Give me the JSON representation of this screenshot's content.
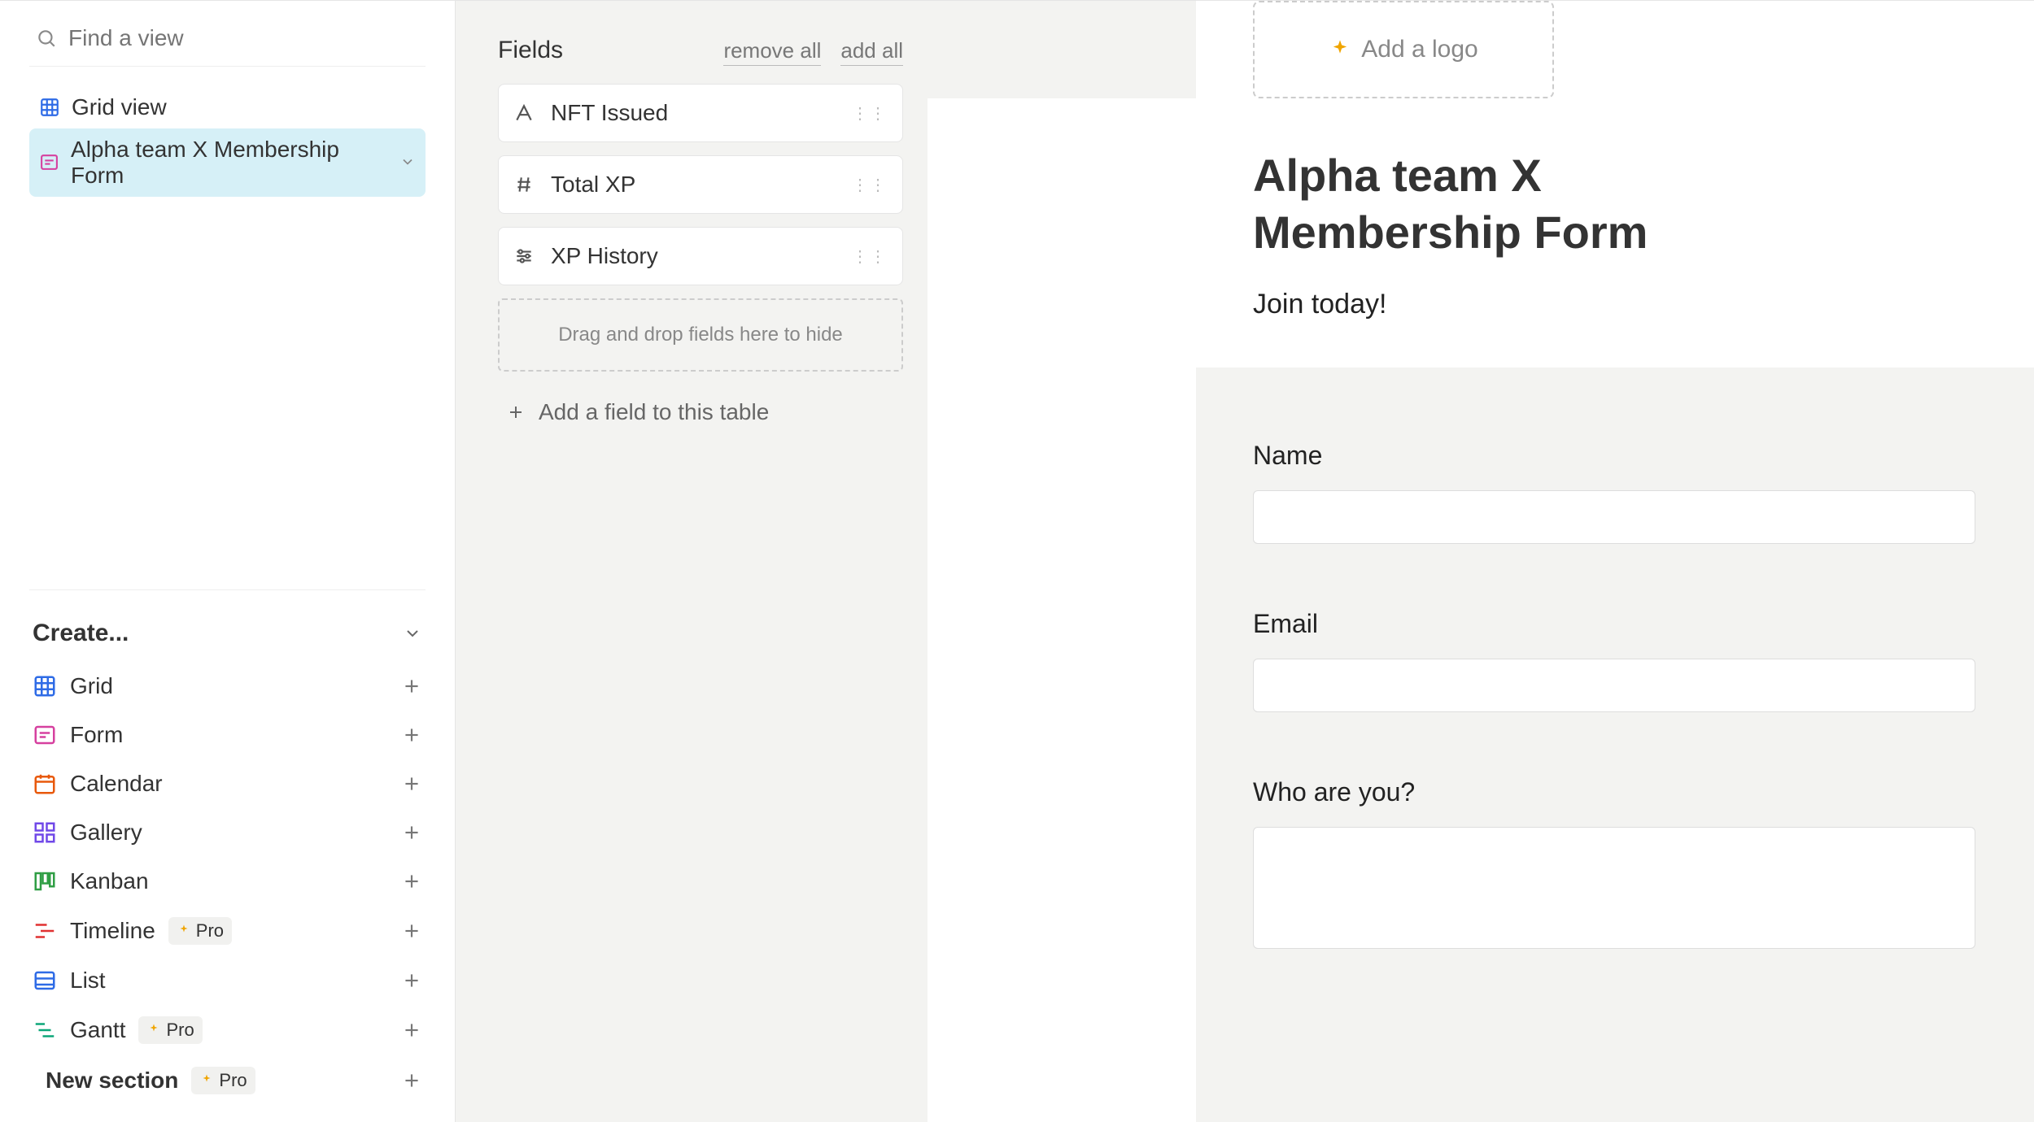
{
  "sidebar": {
    "search_placeholder": "Find a view",
    "views": [
      {
        "label": "Grid view"
      },
      {
        "label": "Alpha team X Membership Form"
      }
    ],
    "create_header": "Create...",
    "create_items": [
      {
        "label": "Grid",
        "pro": false
      },
      {
        "label": "Form",
        "pro": false
      },
      {
        "label": "Calendar",
        "pro": false
      },
      {
        "label": "Gallery",
        "pro": false
      },
      {
        "label": "Kanban",
        "pro": false
      },
      {
        "label": "Timeline",
        "pro": true,
        "pro_label": "Pro"
      },
      {
        "label": "List",
        "pro": false
      },
      {
        "label": "Gantt",
        "pro": true,
        "pro_label": "Pro"
      },
      {
        "label": "New section",
        "pro": true,
        "pro_label": "Pro"
      }
    ]
  },
  "fields_panel": {
    "title": "Fields",
    "remove_all": "remove all",
    "add_all": "add all",
    "fields": [
      {
        "label": "NFT Issued"
      },
      {
        "label": "Total XP"
      },
      {
        "label": "XP History"
      }
    ],
    "dropzone_text": "Drag and drop fields here to hide",
    "add_field_label": "Add a field to this table"
  },
  "form": {
    "add_logo": "Add a logo",
    "title": "Alpha team X Membership Form",
    "subtitle": "Join today!",
    "questions": [
      {
        "label": "Name"
      },
      {
        "label": "Email"
      },
      {
        "label": "Who are you?"
      }
    ]
  }
}
